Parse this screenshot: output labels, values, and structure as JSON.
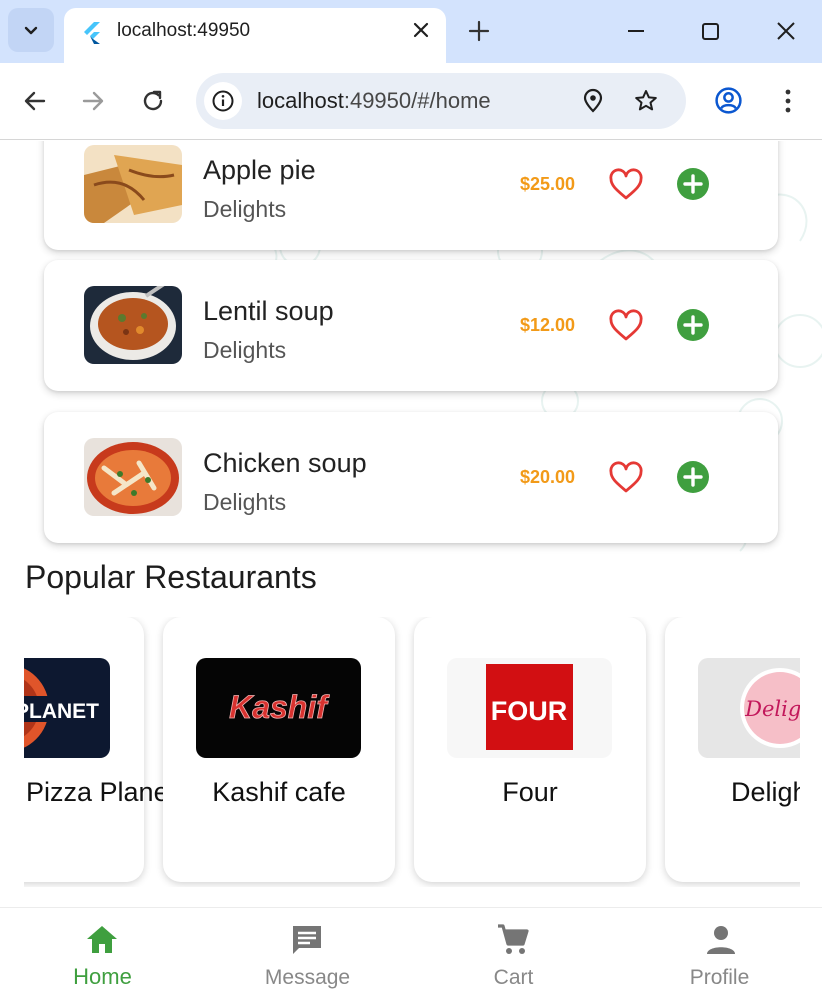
{
  "browser": {
    "tab_title": "localhost:49950",
    "url_host": "localhost",
    "url_rest": ":49950/#/home"
  },
  "foods": [
    {
      "name": "Apple pie",
      "category": "Delights",
      "price": "$25.00"
    },
    {
      "name": "Lentil soup",
      "category": "Delights",
      "price": "$12.00"
    },
    {
      "name": "Chicken soup",
      "category": "Delights",
      "price": "$20.00"
    }
  ],
  "popular_title": "Popular Restaurants",
  "restaurants": [
    {
      "name": "Pizza Planet",
      "logo_text": "PLANET"
    },
    {
      "name": "Kashif cafe",
      "logo_text": "Kashif"
    },
    {
      "name": "Four",
      "logo_text": "FOUR"
    },
    {
      "name": "Delights",
      "logo_text": "Deligh"
    }
  ],
  "bottom_nav": [
    {
      "label": "Home",
      "icon": "home-icon",
      "active": true
    },
    {
      "label": "Message",
      "icon": "message-icon",
      "active": false
    },
    {
      "label": "Cart",
      "icon": "cart-icon",
      "active": false
    },
    {
      "label": "Profile",
      "icon": "person-icon",
      "active": false
    }
  ],
  "colors": {
    "accent_green": "#3f9f3f",
    "price_orange": "#f29a18",
    "heart_red": "#e53935",
    "tab_strip": "#d3e3fd"
  }
}
